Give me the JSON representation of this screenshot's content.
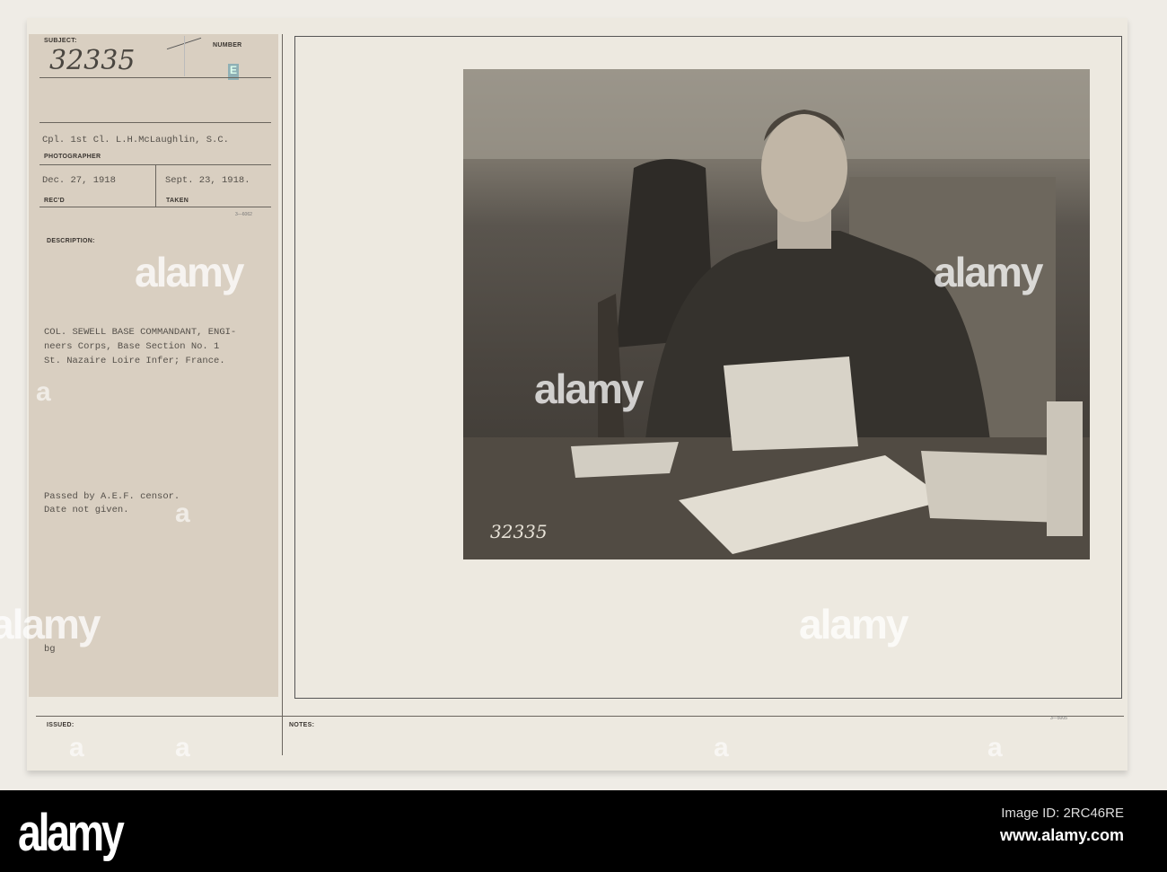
{
  "card": {
    "subject_label": "SUBJECT:",
    "subject_number": "32335",
    "number_label": "NUMBER",
    "number_stamp": "E",
    "photographer": "Cpl. 1st Cl. L.H.McLaughlin, S.C.",
    "photographer_label": "PHOTOGRAPHER",
    "recd_date": "Dec. 27, 1918",
    "recd_label": "REC'D",
    "taken_date": "Sept. 23, 1918.",
    "taken_label": "TAKEN",
    "form_code_top": "3—6062",
    "description_label": "DESCRIPTION:",
    "description": "COL. SEWELL BASE COMMANDANT, ENGI-\nneers Corps, Base Section No. 1\nSt. Nazaire Loire Infer; France.",
    "censor_note": "Passed by A.E.F. censor.\nDate not given.",
    "initials": "bg",
    "issued_label": "ISSUED:",
    "notes_label": "NOTES:",
    "form_code_bottom": "3—5005",
    "photo_number": "32335"
  },
  "watermark": {
    "word": "alamy",
    "letter": "a"
  },
  "footer": {
    "logo": "alamy",
    "image_id": "Image ID: 2RC46RE",
    "url": "www.alamy.com"
  }
}
